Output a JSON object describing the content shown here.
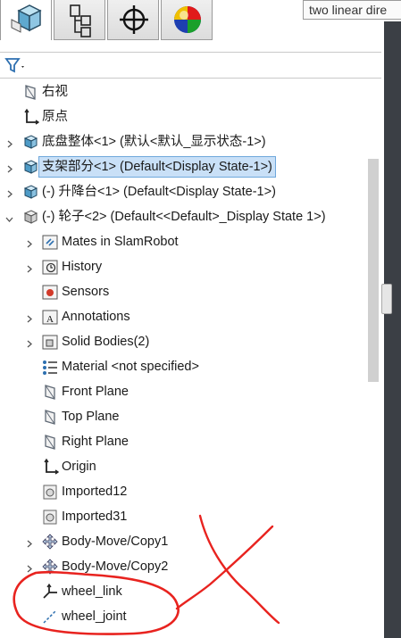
{
  "tooltip": "two linear dire",
  "toolbar": {
    "tabs": [
      {
        "name": "featuremanager-tab",
        "icon": "part-cube-icon"
      },
      {
        "name": "propertymanager-tab",
        "icon": "property-tree-icon"
      },
      {
        "name": "configurationmanager-tab",
        "icon": "crosshair-icon"
      },
      {
        "name": "displaymanager-tab",
        "icon": "color-sphere-icon"
      }
    ]
  },
  "filter": {
    "icon": "filter-icon"
  },
  "tree": [
    {
      "label": "右视",
      "icon": "plane",
      "indent": 0,
      "expand": false
    },
    {
      "label": "原点",
      "icon": "origin",
      "indent": 0,
      "expand": false
    },
    {
      "label": "底盘整体<1> (默认<默认_显示状态-1>)",
      "icon": "part",
      "indent": 0,
      "expand": true
    },
    {
      "label": "支架部分<1> (Default<Display State-1>)",
      "icon": "part",
      "indent": 0,
      "expand": true,
      "selected": true
    },
    {
      "label": "(-) 升降台<1> (Default<Display State-1>)",
      "icon": "part",
      "indent": 0,
      "expand": true
    },
    {
      "label": "(-) 轮子<2> (Default<<Default>_Display State 1>)",
      "icon": "part-gray",
      "indent": 0,
      "expand": "open"
    },
    {
      "label": "Mates in SlamRobot",
      "icon": "folder-mates",
      "indent": 1,
      "expand": true
    },
    {
      "label": "History",
      "icon": "folder-history",
      "indent": 1,
      "expand": true
    },
    {
      "label": "Sensors",
      "icon": "folder-sensors",
      "indent": 1,
      "expand": false
    },
    {
      "label": "Annotations",
      "icon": "folder-annotations",
      "indent": 1,
      "expand": true
    },
    {
      "label": "Solid Bodies(2)",
      "icon": "folder-bodies",
      "indent": 1,
      "expand": true
    },
    {
      "label": "Material <not specified>",
      "icon": "material",
      "indent": 1,
      "expand": false
    },
    {
      "label": "Front Plane",
      "icon": "plane",
      "indent": 1,
      "expand": false
    },
    {
      "label": "Top Plane",
      "icon": "plane",
      "indent": 1,
      "expand": false
    },
    {
      "label": "Right Plane",
      "icon": "plane",
      "indent": 1,
      "expand": false
    },
    {
      "label": "Origin",
      "icon": "origin",
      "indent": 1,
      "expand": false
    },
    {
      "label": "Imported12",
      "icon": "imported",
      "indent": 1,
      "expand": false
    },
    {
      "label": "Imported31",
      "icon": "imported",
      "indent": 1,
      "expand": false
    },
    {
      "label": "Body-Move/Copy1",
      "icon": "move-copy",
      "indent": 1,
      "expand": true
    },
    {
      "label": "Body-Move/Copy2",
      "icon": "move-copy",
      "indent": 1,
      "expand": true
    },
    {
      "label": "wheel_link",
      "icon": "coord-system",
      "indent": 1,
      "expand": false
    },
    {
      "label": "wheel_joint",
      "icon": "axis",
      "indent": 1,
      "expand": false
    }
  ],
  "colors": {
    "selection": "#c9e0f7",
    "annotation": "#e8231f",
    "viewport": "#3b3f45"
  }
}
